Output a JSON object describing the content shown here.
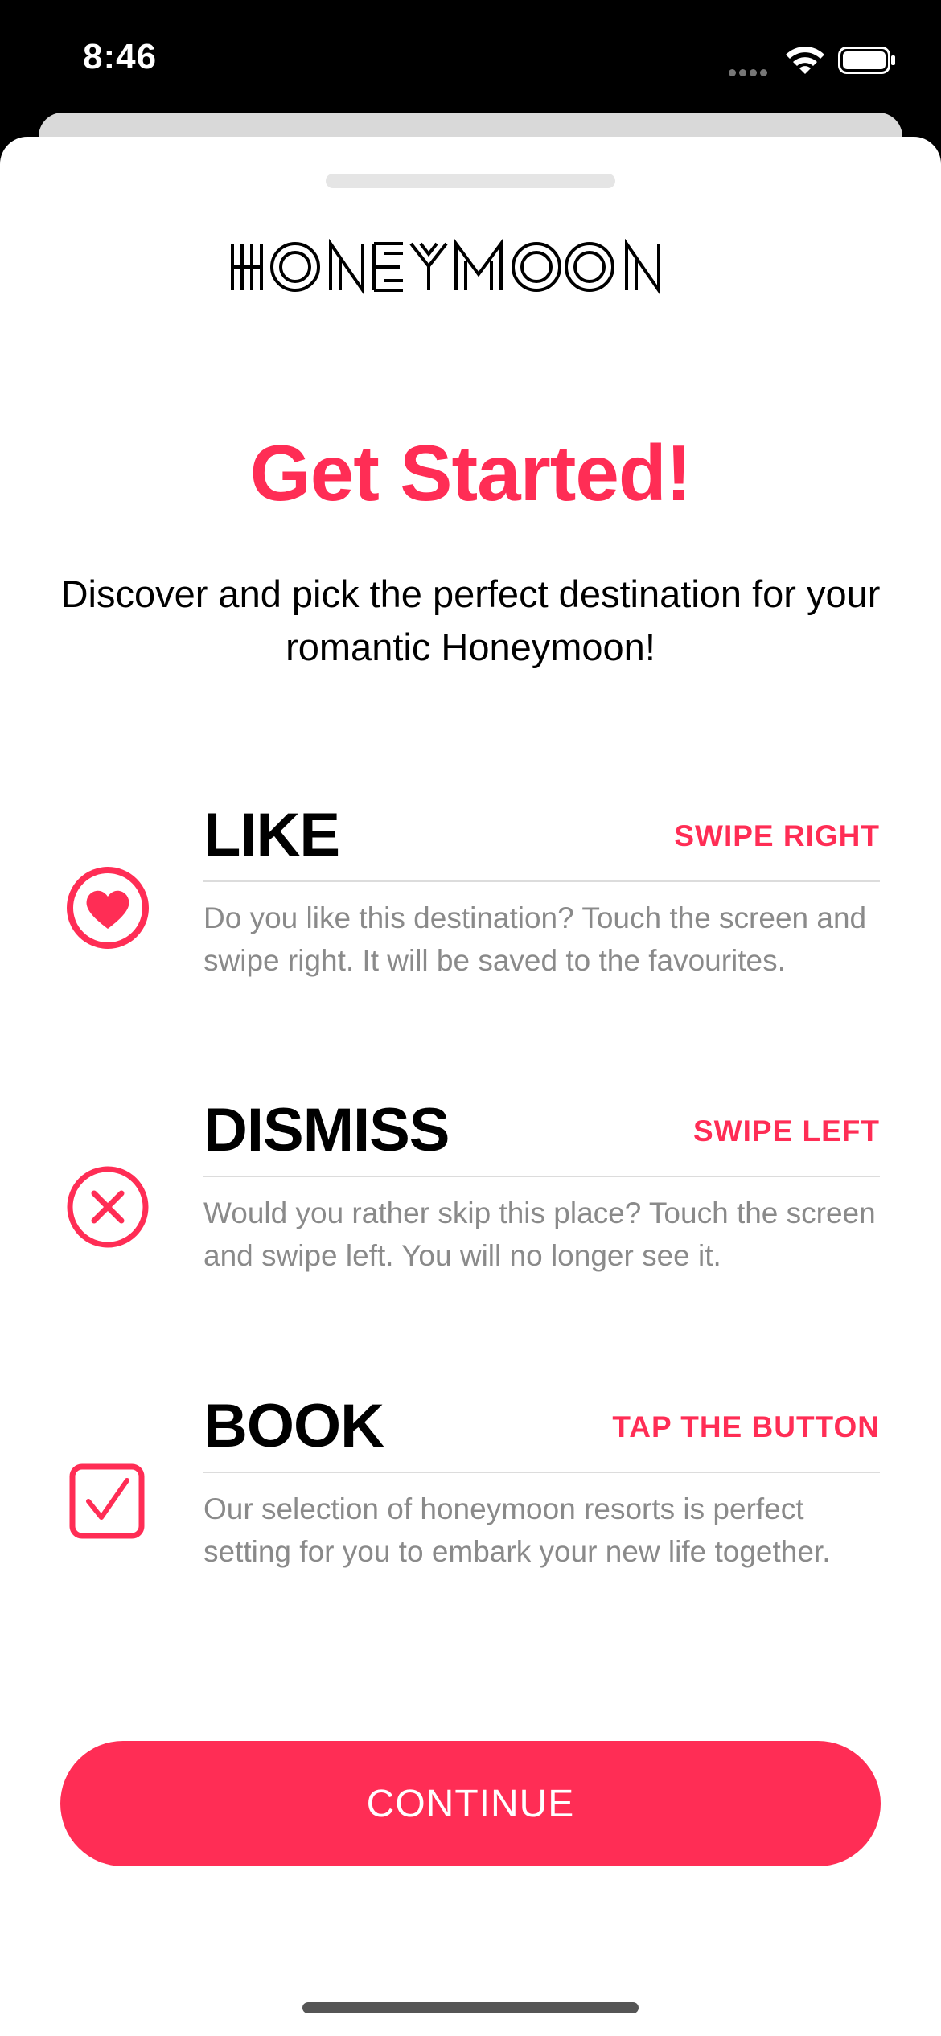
{
  "status_bar": {
    "time": "8:46"
  },
  "app": {
    "logo_text": "HONEYMOON",
    "title": "Get Started!",
    "subtitle": "Discover and pick the perfect destination for your romantic Honeymoon!"
  },
  "features": [
    {
      "title": "LIKE",
      "action": "SWIPE RIGHT",
      "description": "Do you like this destination? Touch the screen and swipe right. It will be saved to the favourites.",
      "icon": "heart-circle-icon"
    },
    {
      "title": "DISMISS",
      "action": "SWIPE LEFT",
      "description": "Would you rather skip this place? Touch the screen and swipe left. You will no longer see it.",
      "icon": "x-circle-icon"
    },
    {
      "title": "BOOK",
      "action": "TAP THE BUTTON",
      "description": "Our selection of honeymoon resorts is perfect setting for you to embark your new life together.",
      "icon": "checkmark-square-icon"
    }
  ],
  "continue_label": "CONTINUE",
  "colors": {
    "accent": "#ff2d55",
    "text": "#000000",
    "secondary": "#8a8a8a"
  }
}
